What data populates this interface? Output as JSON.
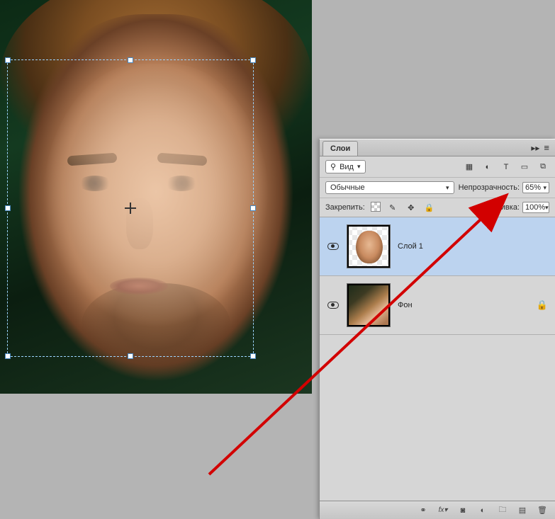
{
  "panel": {
    "tab_title": "Слои",
    "search_mode": "Вид",
    "blend_mode": "Обычные",
    "opacity_label": "Непрозрачность:",
    "opacity_value": "65%",
    "fill_label": "Заливка:",
    "fill_value": "100%",
    "lock_label": "Закрепить:"
  },
  "layers": [
    {
      "name": "Слой 1",
      "visible": true,
      "selected": true,
      "locked": false
    },
    {
      "name": "Фон",
      "visible": true,
      "selected": false,
      "locked": true
    }
  ],
  "icons": {
    "search": "⚲",
    "filter_pixel": "▦",
    "filter_adjust": "◐",
    "filter_type": "T",
    "filter_shape": "▭",
    "filter_smart": "⧉",
    "brush": "✎",
    "move": "✥",
    "lock": "🔒",
    "link": "⚭",
    "fx": "fx▾",
    "mask": "◙",
    "adjust": "◐",
    "folder": "🗀",
    "new": "▤",
    "trash": "🗑",
    "collapse": "▸▸",
    "menu": "≡"
  }
}
